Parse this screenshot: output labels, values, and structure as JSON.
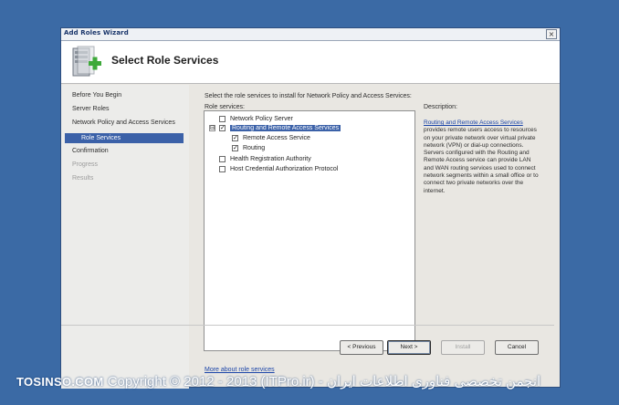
{
  "window": {
    "title": "Add Roles Wizard",
    "close_glyph": "×"
  },
  "header": {
    "title": "Select Role Services",
    "icon": "server-add-icon"
  },
  "nav": {
    "items": [
      {
        "label": "Before You Begin",
        "state": "normal"
      },
      {
        "label": "Server Roles",
        "state": "normal"
      },
      {
        "label": "Network Policy and Access Services",
        "state": "normal"
      },
      {
        "label": "Role Services",
        "state": "active"
      },
      {
        "label": "Confirmation",
        "state": "normal"
      },
      {
        "label": "Progress",
        "state": "disabled"
      },
      {
        "label": "Results",
        "state": "disabled"
      }
    ]
  },
  "main": {
    "instruction": "Select the role services to install for Network Policy and Access Services:",
    "role_services_label": "Role services:",
    "description_label": "Description:",
    "tree": [
      {
        "label": "Network Policy Server",
        "checked": false,
        "level": 0
      },
      {
        "label": "Routing and Remote Access Services",
        "checked": true,
        "level": 0,
        "selected": true,
        "expander": "⊟"
      },
      {
        "label": "Remote Access Service",
        "checked": true,
        "level": 1
      },
      {
        "label": "Routing",
        "checked": true,
        "level": 1
      },
      {
        "label": "Health Registration Authority",
        "checked": false,
        "level": 0
      },
      {
        "label": "Host Credential Authorization Protocol",
        "checked": false,
        "level": 0
      }
    ],
    "description": {
      "link": "Routing and Remote Access Services",
      "text": "provides remote users access to resources on your private network over virtual private network (VPN) or dial-up connections. Servers configured with the Routing and Remote Access service can provide LAN and WAN routing services used to connect network segments within a small office or to connect two private networks over the internet."
    },
    "more_link": "More about role services"
  },
  "buttons": {
    "previous": "< Previous",
    "next": "Next >",
    "install": "Install",
    "cancel": "Cancel"
  },
  "watermark": {
    "brand": "TOSINSO.COM",
    "text": "Copyright © 2012 - 2013 (ITPro.ir) - انجمن تخصصی فناوری اطلاعات ایران"
  },
  "colors": {
    "desktop": "#3b6aa5",
    "selection": "#3b61a8",
    "link": "#1a44a8"
  }
}
